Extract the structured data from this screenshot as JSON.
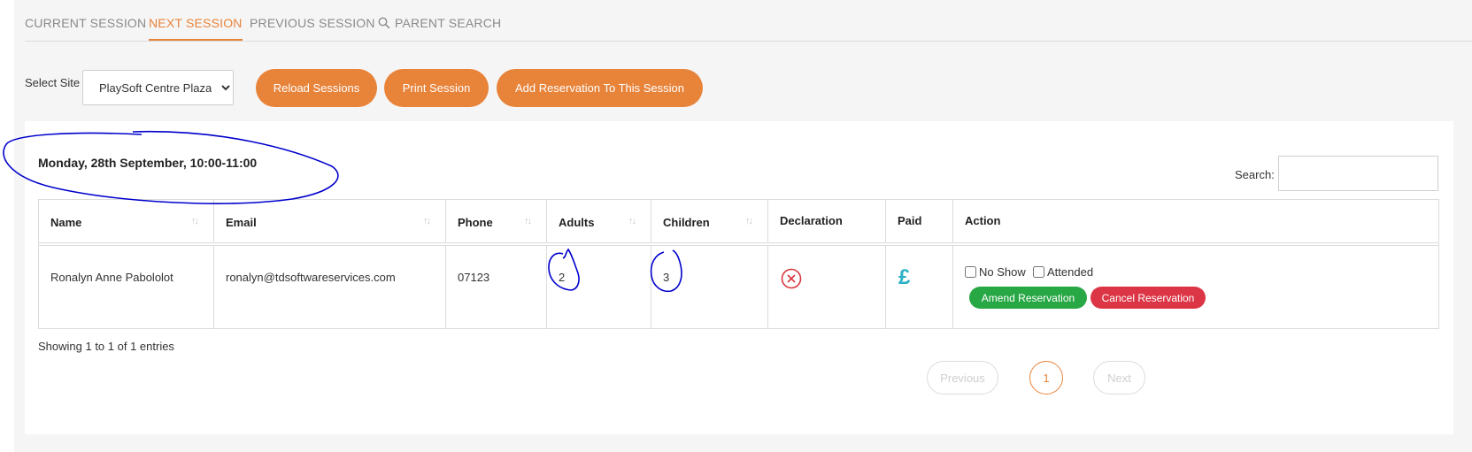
{
  "tabs": [
    {
      "label": "CURRENT SESSION",
      "active": false
    },
    {
      "label": "NEXT SESSION",
      "active": true
    },
    {
      "label": "PREVIOUS SESSION",
      "active": false
    },
    {
      "label": "PARENT SEARCH",
      "active": false,
      "icon": "search-icon"
    }
  ],
  "toolbar": {
    "site_label": "Select Site",
    "site_value": "PlaySoft Centre Plaza",
    "reload_label": "Reload Sessions",
    "print_label": "Print Session",
    "add_label": "Add Reservation To This Session"
  },
  "session": {
    "title": "Monday, 28th September, 10:00-11:00",
    "search_label": "Search:",
    "search_value": ""
  },
  "table": {
    "columns": [
      "Name",
      "Email",
      "Phone",
      "Adults",
      "Children",
      "Declaration",
      "Paid",
      "Action"
    ],
    "sort_glyph": "↑↓",
    "rows": [
      {
        "name": "Ronalyn Anne Pabololot",
        "email": "ronalyn@tdsoftwareservices.com",
        "phone": "07123",
        "adults": "2",
        "children": "3",
        "declaration_icon": "x-circle-icon",
        "paid_icon": "pound-icon",
        "paid_symbol": "£",
        "no_show_label": "No Show",
        "attended_label": "Attended",
        "amend_label": "Amend Reservation",
        "cancel_label": "Cancel Reservation"
      }
    ]
  },
  "footer": {
    "entries_text": "Showing 1 to 1 of 1 entries",
    "previous_label": "Previous",
    "page_label": "1",
    "next_label": "Next"
  },
  "colors": {
    "accent": "#e8833a",
    "green": "#28a745",
    "red": "#dc3545",
    "paid": "#2ab0c5",
    "annotation": "#0000cc"
  }
}
